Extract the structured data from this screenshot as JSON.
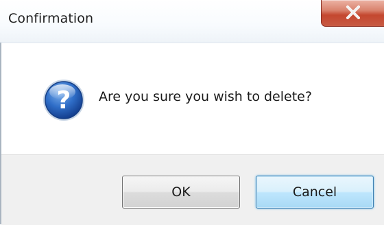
{
  "window": {
    "title": "Confirmation",
    "close_icon": "close-x-icon"
  },
  "dialog": {
    "icon": "question-icon",
    "message": "Are you sure you wish to delete?"
  },
  "buttons": {
    "ok_label": "OK",
    "cancel_label": "Cancel"
  },
  "colors": {
    "close_button": "#c75a43",
    "question_icon": "#1b4fa8",
    "cancel_focus_border": "#3c7fb1"
  }
}
